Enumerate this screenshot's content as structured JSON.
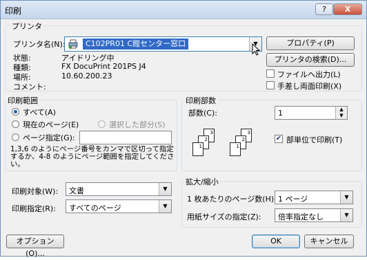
{
  "window": {
    "title": "印刷"
  },
  "titlebar": {
    "help_label": "?",
    "close_label": "X"
  },
  "printer": {
    "group_label": "プリンタ",
    "name_label": "プリンタ名(N):",
    "name_value": "C102PR01 C館センター窓口",
    "status_label": "状態:",
    "status_value": "アイドリング中",
    "type_label": "種類:",
    "type_value": "FX DocuPrint 201PS J4",
    "location_label": "場所:",
    "location_value": "10.60.200.23",
    "comment_label": "コメント:",
    "comment_value": "",
    "properties_button": "プロパティ(P)",
    "find_printer_button": "プリンタの検索(D)...",
    "print_to_file_label": "ファイルへ出力(L)",
    "manual_duplex_label": "手差し両面印刷(X)"
  },
  "range": {
    "group_label": "印刷範囲",
    "all_label": "すべて(A)",
    "current_page_label": "現在のページ(E)",
    "selection_label": "選択した部分(S)",
    "pages_label": "ページ指定(G):",
    "pages_value": "",
    "hint_text_1": "1,3,6 のようにページ番号をカンマで区切って指定",
    "hint_text_2": "するか、4-8 のようにページ範囲を指定してくださ",
    "hint_text_3": "い。"
  },
  "copies": {
    "group_label": "印刷部数",
    "count_label": "部数(C):",
    "count_value": "1",
    "collate_label": "部単位で印刷(T)",
    "collate_checked": true
  },
  "print_what": {
    "label": "印刷対象(W):",
    "value": "文書"
  },
  "print_mode": {
    "label": "印刷指定(R):",
    "value": "すべてのページ"
  },
  "zoom": {
    "group_label": "拡大/縮小",
    "pages_per_sheet_label": "1 枚あたりのページ数(H):",
    "pages_per_sheet_value": "1 ページ",
    "scale_label": "用紙サイズの指定(Z):",
    "scale_value": "倍率指定なし"
  },
  "footer": {
    "options_button": "オプション(O)...",
    "ok_button": "OK",
    "cancel_button": "キャンセル"
  }
}
